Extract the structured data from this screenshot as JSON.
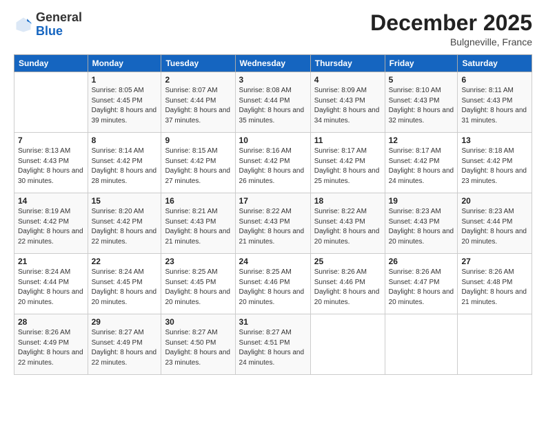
{
  "logo": {
    "general": "General",
    "blue": "Blue"
  },
  "header": {
    "month": "December 2025",
    "location": "Bulgneville, France"
  },
  "weekdays": [
    "Sunday",
    "Monday",
    "Tuesday",
    "Wednesday",
    "Thursday",
    "Friday",
    "Saturday"
  ],
  "weeks": [
    [
      {
        "day": "",
        "sunrise": "",
        "sunset": "",
        "daylight": ""
      },
      {
        "day": "1",
        "sunrise": "Sunrise: 8:05 AM",
        "sunset": "Sunset: 4:45 PM",
        "daylight": "Daylight: 8 hours and 39 minutes."
      },
      {
        "day": "2",
        "sunrise": "Sunrise: 8:07 AM",
        "sunset": "Sunset: 4:44 PM",
        "daylight": "Daylight: 8 hours and 37 minutes."
      },
      {
        "day": "3",
        "sunrise": "Sunrise: 8:08 AM",
        "sunset": "Sunset: 4:44 PM",
        "daylight": "Daylight: 8 hours and 35 minutes."
      },
      {
        "day": "4",
        "sunrise": "Sunrise: 8:09 AM",
        "sunset": "Sunset: 4:43 PM",
        "daylight": "Daylight: 8 hours and 34 minutes."
      },
      {
        "day": "5",
        "sunrise": "Sunrise: 8:10 AM",
        "sunset": "Sunset: 4:43 PM",
        "daylight": "Daylight: 8 hours and 32 minutes."
      },
      {
        "day": "6",
        "sunrise": "Sunrise: 8:11 AM",
        "sunset": "Sunset: 4:43 PM",
        "daylight": "Daylight: 8 hours and 31 minutes."
      }
    ],
    [
      {
        "day": "7",
        "sunrise": "Sunrise: 8:13 AM",
        "sunset": "Sunset: 4:43 PM",
        "daylight": "Daylight: 8 hours and 30 minutes."
      },
      {
        "day": "8",
        "sunrise": "Sunrise: 8:14 AM",
        "sunset": "Sunset: 4:42 PM",
        "daylight": "Daylight: 8 hours and 28 minutes."
      },
      {
        "day": "9",
        "sunrise": "Sunrise: 8:15 AM",
        "sunset": "Sunset: 4:42 PM",
        "daylight": "Daylight: 8 hours and 27 minutes."
      },
      {
        "day": "10",
        "sunrise": "Sunrise: 8:16 AM",
        "sunset": "Sunset: 4:42 PM",
        "daylight": "Daylight: 8 hours and 26 minutes."
      },
      {
        "day": "11",
        "sunrise": "Sunrise: 8:17 AM",
        "sunset": "Sunset: 4:42 PM",
        "daylight": "Daylight: 8 hours and 25 minutes."
      },
      {
        "day": "12",
        "sunrise": "Sunrise: 8:17 AM",
        "sunset": "Sunset: 4:42 PM",
        "daylight": "Daylight: 8 hours and 24 minutes."
      },
      {
        "day": "13",
        "sunrise": "Sunrise: 8:18 AM",
        "sunset": "Sunset: 4:42 PM",
        "daylight": "Daylight: 8 hours and 23 minutes."
      }
    ],
    [
      {
        "day": "14",
        "sunrise": "Sunrise: 8:19 AM",
        "sunset": "Sunset: 4:42 PM",
        "daylight": "Daylight: 8 hours and 22 minutes."
      },
      {
        "day": "15",
        "sunrise": "Sunrise: 8:20 AM",
        "sunset": "Sunset: 4:42 PM",
        "daylight": "Daylight: 8 hours and 22 minutes."
      },
      {
        "day": "16",
        "sunrise": "Sunrise: 8:21 AM",
        "sunset": "Sunset: 4:43 PM",
        "daylight": "Daylight: 8 hours and 21 minutes."
      },
      {
        "day": "17",
        "sunrise": "Sunrise: 8:22 AM",
        "sunset": "Sunset: 4:43 PM",
        "daylight": "Daylight: 8 hours and 21 minutes."
      },
      {
        "day": "18",
        "sunrise": "Sunrise: 8:22 AM",
        "sunset": "Sunset: 4:43 PM",
        "daylight": "Daylight: 8 hours and 20 minutes."
      },
      {
        "day": "19",
        "sunrise": "Sunrise: 8:23 AM",
        "sunset": "Sunset: 4:43 PM",
        "daylight": "Daylight: 8 hours and 20 minutes."
      },
      {
        "day": "20",
        "sunrise": "Sunrise: 8:23 AM",
        "sunset": "Sunset: 4:44 PM",
        "daylight": "Daylight: 8 hours and 20 minutes."
      }
    ],
    [
      {
        "day": "21",
        "sunrise": "Sunrise: 8:24 AM",
        "sunset": "Sunset: 4:44 PM",
        "daylight": "Daylight: 8 hours and 20 minutes."
      },
      {
        "day": "22",
        "sunrise": "Sunrise: 8:24 AM",
        "sunset": "Sunset: 4:45 PM",
        "daylight": "Daylight: 8 hours and 20 minutes."
      },
      {
        "day": "23",
        "sunrise": "Sunrise: 8:25 AM",
        "sunset": "Sunset: 4:45 PM",
        "daylight": "Daylight: 8 hours and 20 minutes."
      },
      {
        "day": "24",
        "sunrise": "Sunrise: 8:25 AM",
        "sunset": "Sunset: 4:46 PM",
        "daylight": "Daylight: 8 hours and 20 minutes."
      },
      {
        "day": "25",
        "sunrise": "Sunrise: 8:26 AM",
        "sunset": "Sunset: 4:46 PM",
        "daylight": "Daylight: 8 hours and 20 minutes."
      },
      {
        "day": "26",
        "sunrise": "Sunrise: 8:26 AM",
        "sunset": "Sunset: 4:47 PM",
        "daylight": "Daylight: 8 hours and 20 minutes."
      },
      {
        "day": "27",
        "sunrise": "Sunrise: 8:26 AM",
        "sunset": "Sunset: 4:48 PM",
        "daylight": "Daylight: 8 hours and 21 minutes."
      }
    ],
    [
      {
        "day": "28",
        "sunrise": "Sunrise: 8:26 AM",
        "sunset": "Sunset: 4:49 PM",
        "daylight": "Daylight: 8 hours and 22 minutes."
      },
      {
        "day": "29",
        "sunrise": "Sunrise: 8:27 AM",
        "sunset": "Sunset: 4:49 PM",
        "daylight": "Daylight: 8 hours and 22 minutes."
      },
      {
        "day": "30",
        "sunrise": "Sunrise: 8:27 AM",
        "sunset": "Sunset: 4:50 PM",
        "daylight": "Daylight: 8 hours and 23 minutes."
      },
      {
        "day": "31",
        "sunrise": "Sunrise: 8:27 AM",
        "sunset": "Sunset: 4:51 PM",
        "daylight": "Daylight: 8 hours and 24 minutes."
      },
      {
        "day": "",
        "sunrise": "",
        "sunset": "",
        "daylight": ""
      },
      {
        "day": "",
        "sunrise": "",
        "sunset": "",
        "daylight": ""
      },
      {
        "day": "",
        "sunrise": "",
        "sunset": "",
        "daylight": ""
      }
    ]
  ]
}
